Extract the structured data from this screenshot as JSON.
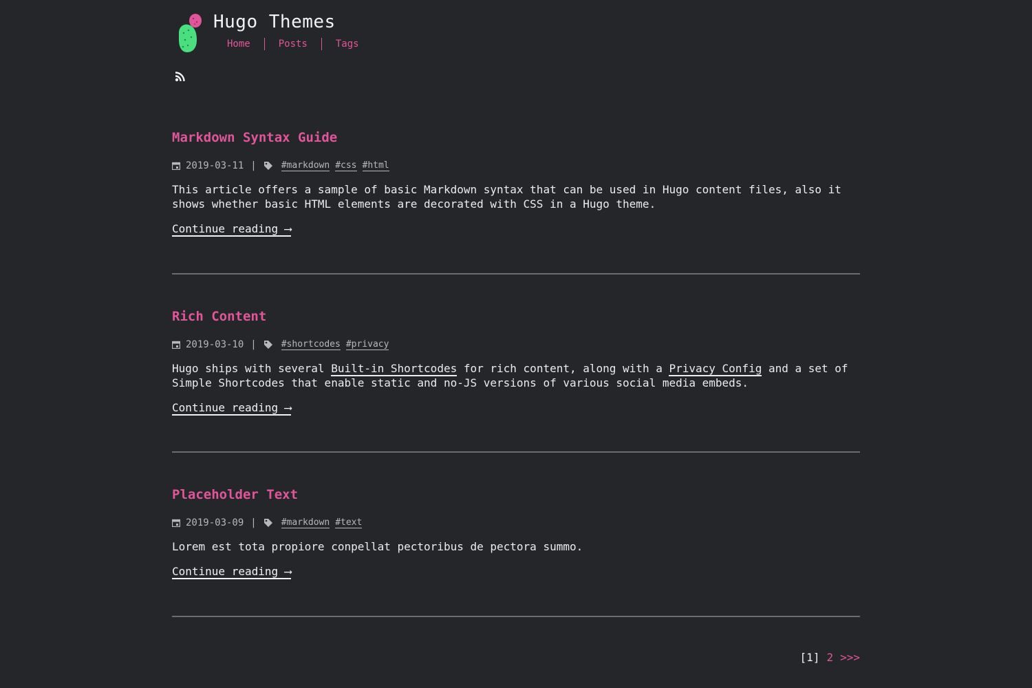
{
  "site": {
    "title": "Hugo Themes",
    "nav": [
      {
        "label": "Home"
      },
      {
        "label": "Posts"
      },
      {
        "label": "Tags"
      }
    ]
  },
  "posts": [
    {
      "title": "Markdown Syntax Guide",
      "date": "2019-03-11",
      "tags": [
        "#markdown",
        "#css",
        "#html"
      ],
      "summary": "This article offers a sample of basic Markdown syntax that can be used in Hugo content files, also it shows whether basic HTML elements are decorated with CSS in a Hugo theme.",
      "more": "Continue reading ⟶"
    },
    {
      "title": "Rich Content",
      "date": "2019-03-10",
      "tags": [
        "#shortcodes",
        "#privacy"
      ],
      "summary_parts": {
        "a": "Hugo ships with several ",
        "link1": "Built-in Shortcodes",
        "b": " for rich content, along with a ",
        "link2": "Privacy Config",
        "c": " and a set of Simple Shortcodes that enable static and no-JS versions of various social media embeds."
      },
      "more": "Continue reading ⟶"
    },
    {
      "title": "Placeholder Text",
      "date": "2019-03-09",
      "tags": [
        "#markdown",
        "#text"
      ],
      "summary": "Lorem est tota propiore conpellat pectoribus de pectora summo.",
      "more": "Continue reading ⟶"
    }
  ],
  "pagination": {
    "current": "[1]",
    "page2": "2",
    "next": ">>>"
  },
  "colors": {
    "background": "#25262a",
    "accent": "#e0569a",
    "text": "#ececec"
  },
  "icons": [
    "logo-cactus-icon",
    "rss-icon",
    "calendar-icon",
    "tag-icon"
  ]
}
